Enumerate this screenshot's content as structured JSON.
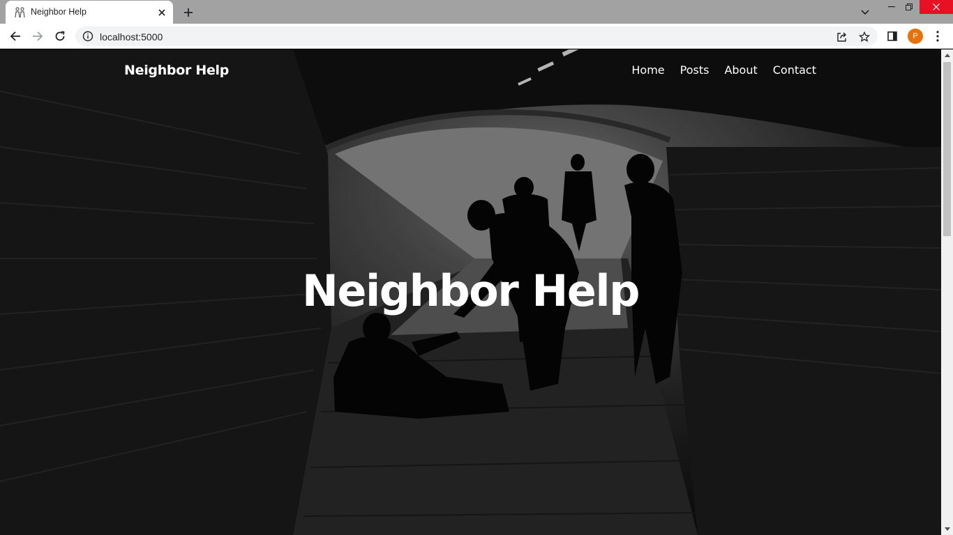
{
  "browser": {
    "tab": {
      "title": "Neighbor Help",
      "favicon": "people-icon"
    },
    "url": "localhost:5000",
    "profile_initial": "P",
    "accent": "#e8710a",
    "close_color": "#e81123"
  },
  "site": {
    "brand": "Neighbor Help",
    "nav": [
      {
        "label": "Home"
      },
      {
        "label": "Posts"
      },
      {
        "label": "About"
      },
      {
        "label": "Contact"
      }
    ],
    "hero_heading": "Neighbor Help",
    "hero_image": "black-and-white-underpass-silhouettes"
  }
}
